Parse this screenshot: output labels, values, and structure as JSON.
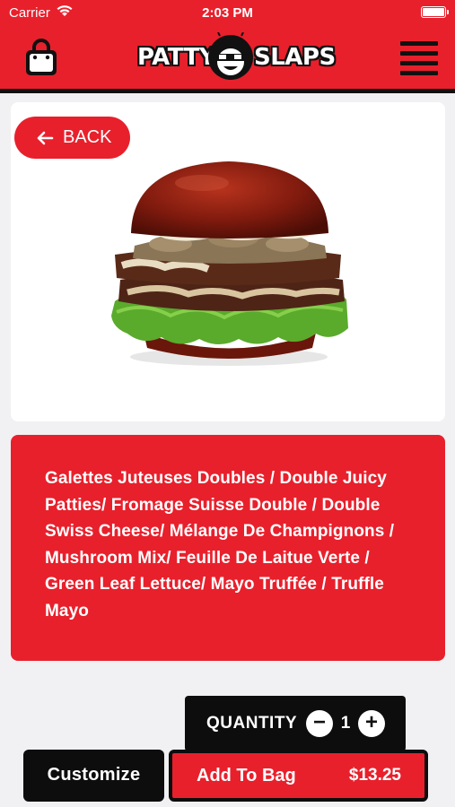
{
  "status_bar": {
    "carrier": "Carrier",
    "time": "2:03 PM"
  },
  "header": {
    "logo_left": "PATTY",
    "logo_right": "SLAPS",
    "bag_icon": "shopping-bag-icon",
    "menu_icon": "hamburger-menu-icon"
  },
  "product": {
    "back_label": "BACK",
    "image": "burger-image",
    "description": "Galettes Juteuses Doubles / Double Juicy Patties/ Fromage Suisse Double / Double Swiss Cheese/ Mélange De Champignons / Mushroom Mix/ Feuille De Laitue Verte / Green Leaf Lettuce/ Mayo Truffée / Truffle Mayo"
  },
  "quantity": {
    "label": "QUANTITY",
    "value": "1",
    "minus": "−",
    "plus": "+"
  },
  "actions": {
    "customize_label": "Customize",
    "add_label": "Add To Bag",
    "price": "$13.25"
  },
  "colors": {
    "brand_red": "#e8202c",
    "dark": "#0d0d0d",
    "background": "#f1f1f3"
  }
}
